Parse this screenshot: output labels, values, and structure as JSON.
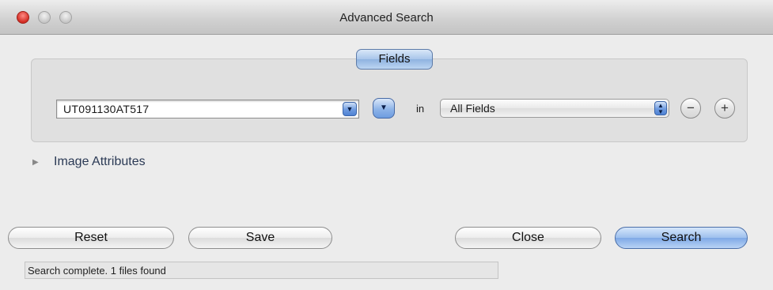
{
  "window": {
    "title": "Advanced Search",
    "traffic_lights": [
      "close",
      "minimize",
      "zoom"
    ]
  },
  "fields_group": {
    "tab_label": "Fields",
    "criteria": {
      "value": "UT091130AT517",
      "in_label": "in",
      "scope": "All Fields",
      "remove_glyph": "−",
      "add_glyph": "+"
    }
  },
  "disclosure": {
    "label": "Image Attributes",
    "expanded": false
  },
  "buttons": {
    "reset": "Reset",
    "save": "Save",
    "close": "Close",
    "search": "Search"
  },
  "status": {
    "text": "Search complete. 1 files found"
  },
  "colors": {
    "accent_blue": "#8fb3e0",
    "close_red": "#d22c23",
    "window_bg": "#ececec"
  }
}
